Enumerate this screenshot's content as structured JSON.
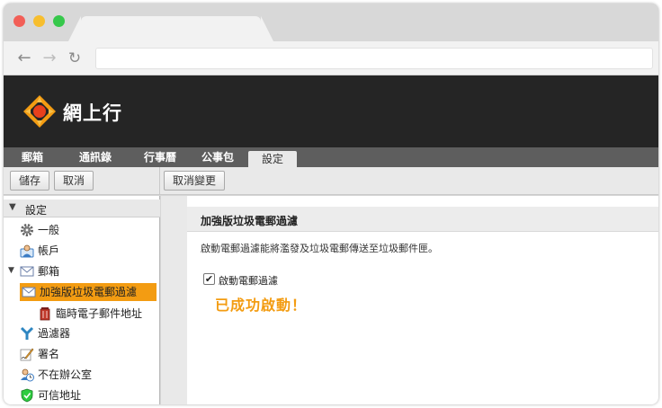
{
  "app": {
    "logo_text": "網上行"
  },
  "modules": [
    {
      "label": "郵箱"
    },
    {
      "label": "通訊錄"
    },
    {
      "label": "行事曆"
    },
    {
      "label": "公事包"
    },
    {
      "label": "設定",
      "active": true
    }
  ],
  "toolbar": {
    "save_label": "儲存",
    "cancel_label": "取消",
    "undo_label": "取消變更"
  },
  "sidebar": {
    "header": "設定",
    "items": [
      {
        "label": "一般",
        "icon": "gear-icon"
      },
      {
        "label": "帳戶",
        "icon": "account-icon"
      },
      {
        "label": "郵箱",
        "icon": "envelope-icon"
      },
      {
        "label": "加強版垃圾電郵過濾",
        "icon": "envelope-icon",
        "selected": true
      },
      {
        "label": "臨時電子郵件地址",
        "icon": "trash-can-icon"
      },
      {
        "label": "過濾器",
        "icon": "filter-icon"
      },
      {
        "label": "署名",
        "icon": "signature-pen-icon"
      },
      {
        "label": "不在辦公室",
        "icon": "out-of-office-icon"
      },
      {
        "label": "可信地址",
        "icon": "shield-check-icon"
      }
    ]
  },
  "content": {
    "title": "加強版垃圾電郵過濾",
    "description": "啟動電郵過濾能將濫發及垃圾電郵傳送至垃圾郵件匣。",
    "checkbox_label": "啟動電郵過濾",
    "checkbox_checked": true,
    "success_message": "已成功啟動！"
  },
  "colors": {
    "accent": "#f39c12",
    "header_bg": "#252525",
    "module_bar": "#5e5e5e"
  }
}
